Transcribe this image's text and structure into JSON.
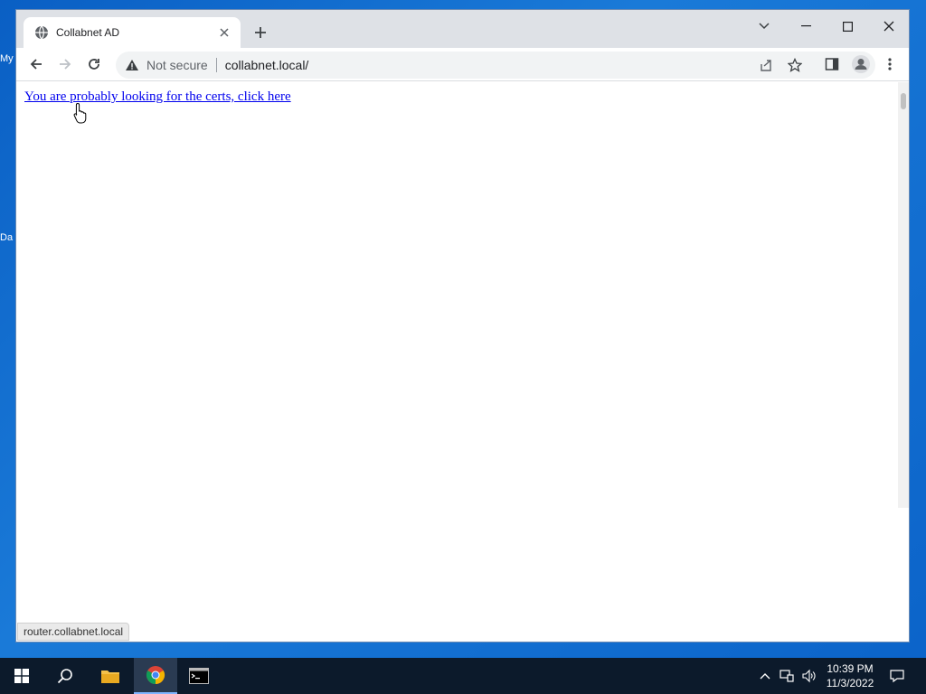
{
  "desktop": {
    "peek_labels": [
      "My",
      "Da"
    ]
  },
  "browser": {
    "tab": {
      "title": "Collabnet AD",
      "icon": "globe-icon"
    },
    "address": {
      "security_label": "Not secure",
      "url": "collabnet.local/"
    },
    "page": {
      "link_text": "You are probably looking for the certs, click here"
    },
    "status_url": "router.collabnet.local"
  },
  "taskbar": {
    "apps": [
      "start-icon",
      "search-icon",
      "file-explorer-icon",
      "chrome-icon",
      "terminal-icon"
    ],
    "clock": {
      "time": "10:39 PM",
      "date": "11/3/2022"
    }
  },
  "colors": {
    "link": "#0000ee",
    "tabstrip": "#dee1e6",
    "taskbar": "#0c1a2b"
  }
}
